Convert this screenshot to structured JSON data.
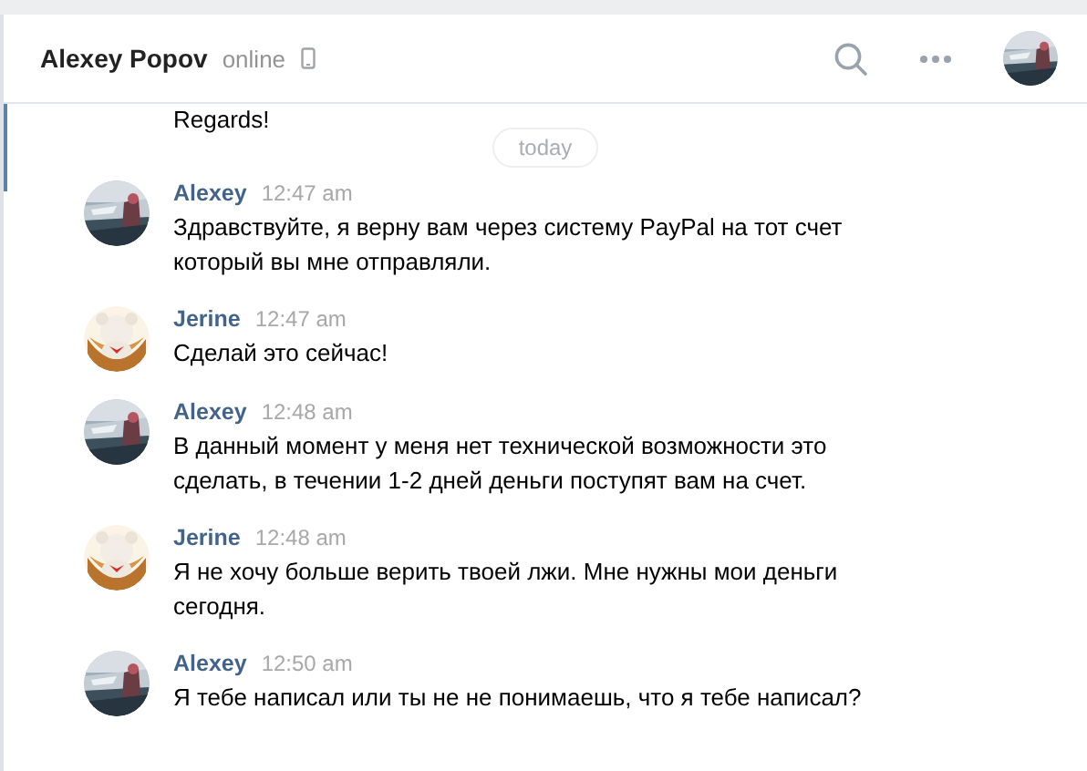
{
  "header": {
    "name": "Alexey Popov",
    "status": "online",
    "mobile": true
  },
  "previous_message": "Regards!",
  "date_divider": "today",
  "messages": [
    {
      "author": "Alexey",
      "time": "12:47 am",
      "text": "Здравствуйте, я верну вам через систему PayPal на тот счет который вы мне отправляли."
    },
    {
      "kind": "toy",
      "author": "Jerine",
      "time": "12:47 am",
      "text": "Сделай это сейчас!"
    },
    {
      "author": "Alexey",
      "time": "12:48 am",
      "text": "В данный момент у меня нет технической возможности это сделать, в течении 1-2 дней деньги поступят вам на счет."
    },
    {
      "kind": "toy",
      "author": "Jerine",
      "time": "12:48 am",
      "text": "Я не хочу больше верить твоей лжи. Мне нужны мои деньги сегодня."
    },
    {
      "author": "Alexey",
      "time": "12:50 am",
      "text": "Я тебе написал или ты не не понимаешь, что я тебе написал?"
    }
  ]
}
